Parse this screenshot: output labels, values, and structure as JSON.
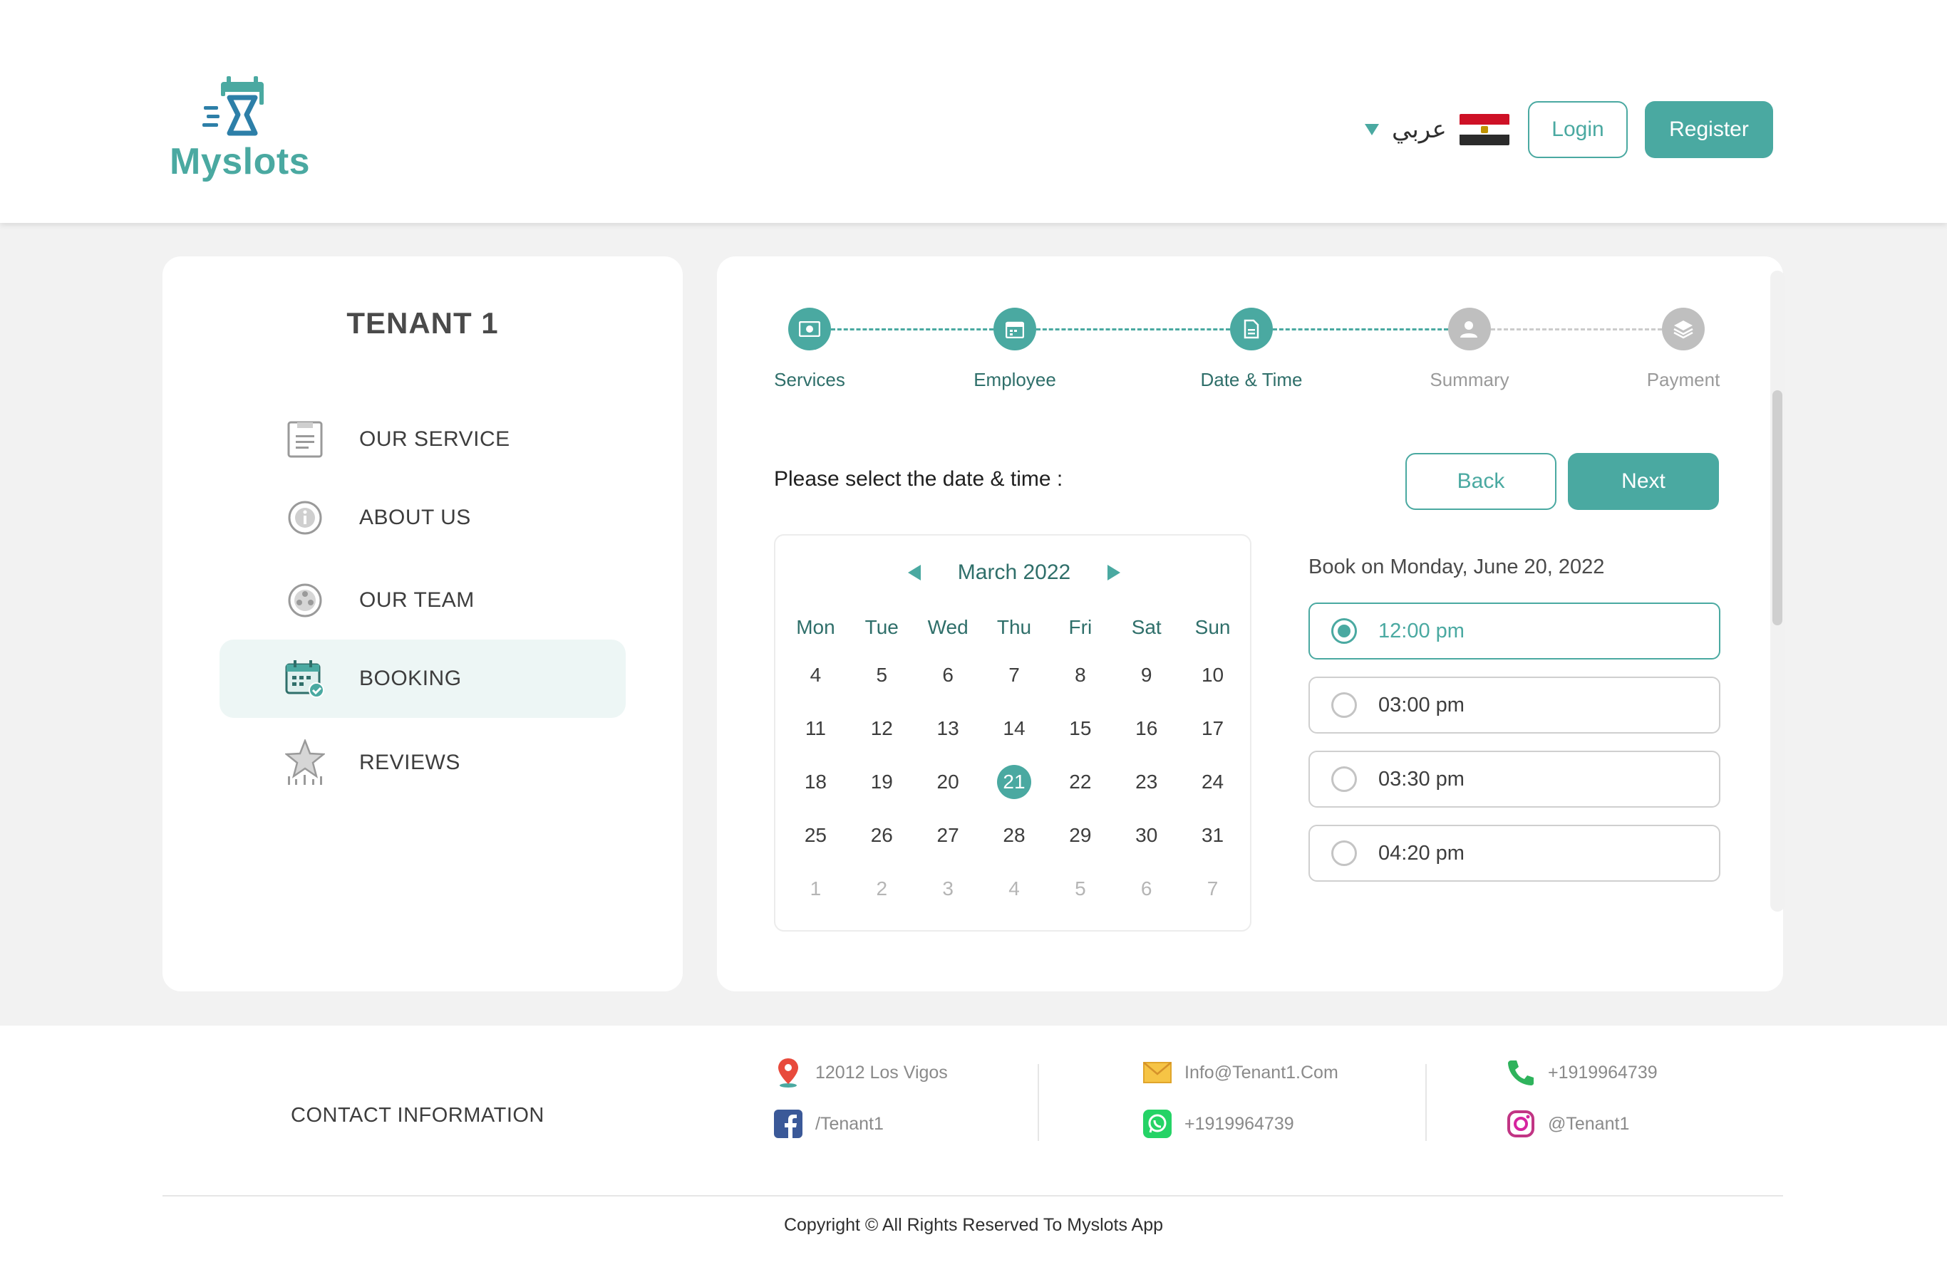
{
  "header": {
    "logo_text": "Myslots",
    "language_label": "عربي",
    "login_label": "Login",
    "register_label": "Register"
  },
  "sidebar": {
    "tenant_name": "TENANT 1",
    "items": [
      {
        "label": "OUR SERVICE",
        "icon": "clipboard-icon"
      },
      {
        "label": "ABOUT US",
        "icon": "info-icon"
      },
      {
        "label": "OUR TEAM",
        "icon": "team-icon"
      },
      {
        "label": "BOOKING",
        "icon": "calendar-check-icon"
      },
      {
        "label": "REVIEWS",
        "icon": "star-icon"
      }
    ]
  },
  "stepper": {
    "steps": [
      {
        "label": "Services",
        "state": "done"
      },
      {
        "label": "Employee",
        "state": "done"
      },
      {
        "label": "Date & Time",
        "state": "done"
      },
      {
        "label": "Summary",
        "state": "todo"
      },
      {
        "label": "Payment",
        "state": "todo"
      }
    ]
  },
  "booking": {
    "prompt": "Please select the date & time :",
    "back_label": "Back",
    "next_label": "Next",
    "book_on": "Book on Monday, June 20, 2022",
    "times": [
      "12:00 pm",
      "03:00 pm",
      "03:30 pm",
      "04:20 pm"
    ],
    "selected_time_index": 0
  },
  "calendar": {
    "month_label": "March 2022",
    "weekdays": [
      "Mon",
      "Tue",
      "Wed",
      "Thu",
      "Fri",
      "Sat",
      "Sun"
    ],
    "weeks": [
      [
        "4",
        "5",
        "6",
        "7",
        "8",
        "9",
        "10"
      ],
      [
        "11",
        "12",
        "13",
        "14",
        "15",
        "16",
        "17"
      ],
      [
        "18",
        "19",
        "20",
        "21",
        "22",
        "23",
        "24"
      ],
      [
        "25",
        "26",
        "27",
        "28",
        "29",
        "30",
        "31"
      ],
      [
        "1",
        "2",
        "3",
        "4",
        "5",
        "6",
        "7"
      ]
    ],
    "selected_day": "21",
    "muted_week_index": 4
  },
  "footer": {
    "contact_title": "CONTACT INFORMATION",
    "address": "12012 Los Vigos",
    "facebook": "/Tenant1",
    "email": "Info@Tenant1.Com",
    "whatsapp": "+1919964739",
    "phone": "+1919964739",
    "instagram": "@Tenant1",
    "copyright": "Copyright © All Rights Reserved To Myslots App"
  },
  "colors": {
    "accent": "#4aa9a1",
    "flag_red": "#ce1126",
    "flag_white": "#ffffff",
    "flag_black": "#2b2b2b"
  }
}
